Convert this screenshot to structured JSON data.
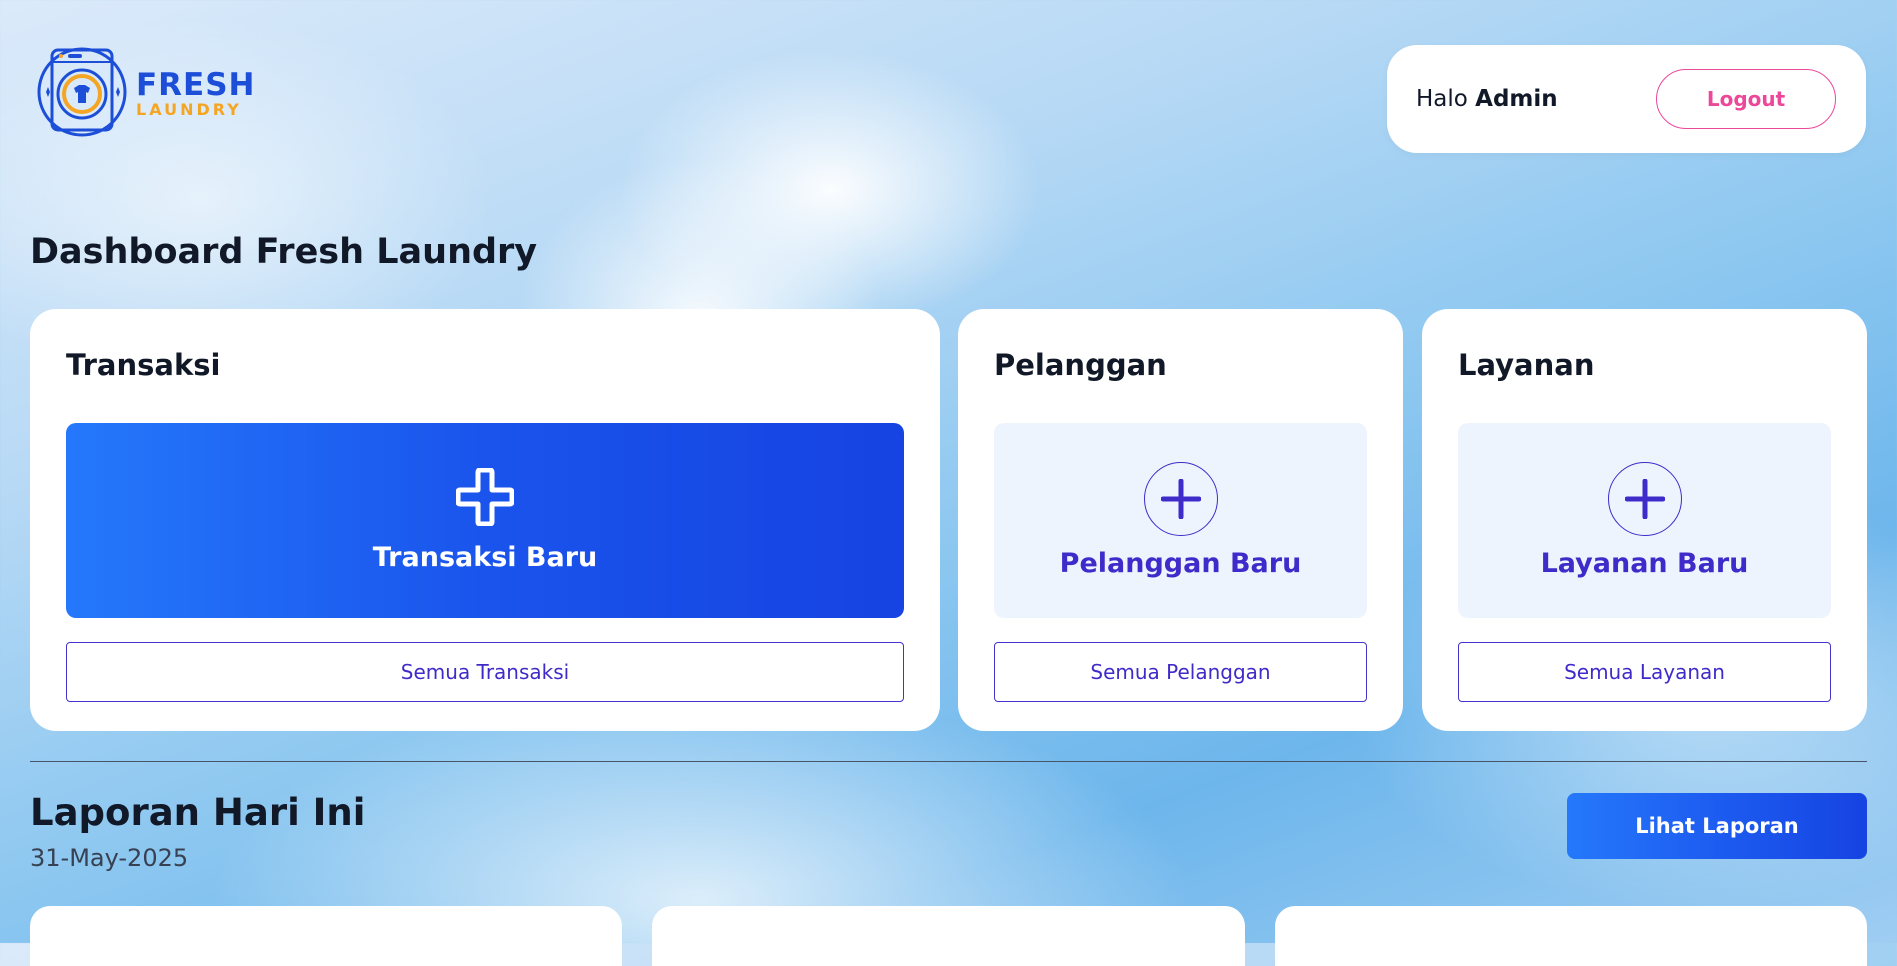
{
  "brand": {
    "line1": "FRESH",
    "line2": "LAUNDRY"
  },
  "header": {
    "greeting_prefix": "Halo",
    "user_name": "Admin",
    "logout_label": "Logout"
  },
  "page": {
    "title": "Dashboard Fresh Laundry"
  },
  "cards": [
    {
      "title": "Transaksi",
      "action_label": "Transaksi Baru",
      "list_label": "Semua Transaksi"
    },
    {
      "title": "Pelanggan",
      "action_label": "Pelanggan Baru",
      "list_label": "Semua Pelanggan"
    },
    {
      "title": "Layanan",
      "action_label": "Layanan Baru",
      "list_label": "Semua Layanan"
    }
  ],
  "report": {
    "title": "Laporan Hari Ini",
    "date": "31-May-2025",
    "button_label": "Lihat Laporan"
  },
  "icons": {
    "logo": "washing-machine-logo-icon",
    "transaction_add": "plus-icon",
    "customer_add": "plus-circle-icon",
    "service_add": "plus-circle-icon"
  },
  "colors": {
    "primary": "#1a54ec",
    "accent_text": "#3f2bc9",
    "logout": "#ec4899",
    "logo_blue": "#1d4ed8",
    "logo_orange": "#f5a524",
    "tile_soft": "#eef4fe"
  }
}
